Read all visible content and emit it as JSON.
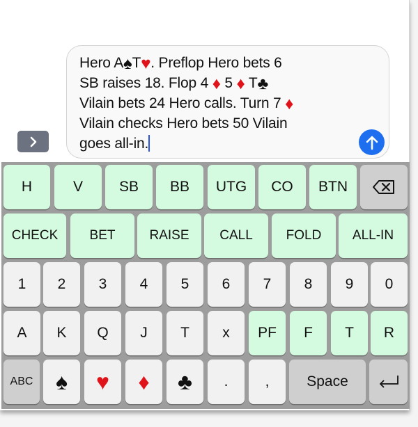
{
  "compose": {
    "expand_icon": "chevron-right-icon",
    "message_lines": [
      [
        {
          "t": "Hero A"
        },
        {
          "suit": "spade"
        },
        {
          "t": "T"
        },
        {
          "suit": "heart"
        },
        {
          "t": ". Preflop Hero bets 6"
        }
      ],
      [
        {
          "t": "SB raises 18. Flop 4 "
        },
        {
          "suit": "diamond"
        },
        {
          "t": " 5 "
        },
        {
          "suit": "diamond"
        },
        {
          "t": " T"
        },
        {
          "suit": "club"
        }
      ],
      [
        {
          "t": "Vilain bets 24 Hero calls. Turn 7 "
        },
        {
          "suit": "diamond"
        }
      ],
      [
        {
          "t": "Vilain checks Hero bets 50 Vilain"
        }
      ],
      [
        {
          "t": "goes all-in."
        },
        {
          "caret": true
        }
      ]
    ],
    "send_icon": "arrow-up-icon"
  },
  "suits": {
    "spade": {
      "glyph": "♠",
      "color": "black"
    },
    "heart": {
      "glyph": "♥",
      "color": "red"
    },
    "diamond": {
      "glyph": "♦",
      "color": "red"
    },
    "club": {
      "glyph": "♣",
      "color": "black"
    }
  },
  "colors": {
    "accent": "#1e6ef0",
    "position_key": "#d4fadf",
    "standard_key": "#f1f1f1",
    "function_key": "#cfcfcf",
    "suit_red": "#e0131a"
  },
  "keyboard": {
    "rows": [
      [
        {
          "label": "H",
          "style": "green"
        },
        {
          "label": "V",
          "style": "green"
        },
        {
          "label": "SB",
          "style": "green"
        },
        {
          "label": "BB",
          "style": "green"
        },
        {
          "label": "UTG",
          "style": "green"
        },
        {
          "label": "CO",
          "style": "green"
        },
        {
          "label": "BTN",
          "style": "green"
        },
        {
          "icon": "backspace-icon",
          "style": "gray"
        }
      ],
      [
        {
          "label": "CHECK",
          "style": "green"
        },
        {
          "label": "BET",
          "style": "green"
        },
        {
          "label": "RAISE",
          "style": "green"
        },
        {
          "label": "CALL",
          "style": "green"
        },
        {
          "label": "FOLD",
          "style": "green"
        },
        {
          "label": "ALL-IN",
          "style": "green"
        }
      ],
      [
        {
          "label": "1",
          "style": "light"
        },
        {
          "label": "2",
          "style": "light"
        },
        {
          "label": "3",
          "style": "light"
        },
        {
          "label": "4",
          "style": "light"
        },
        {
          "label": "5",
          "style": "light"
        },
        {
          "label": "6",
          "style": "light"
        },
        {
          "label": "7",
          "style": "light"
        },
        {
          "label": "8",
          "style": "light"
        },
        {
          "label": "9",
          "style": "light"
        },
        {
          "label": "0",
          "style": "light"
        }
      ],
      [
        {
          "label": "A",
          "style": "light"
        },
        {
          "label": "K",
          "style": "light"
        },
        {
          "label": "Q",
          "style": "light"
        },
        {
          "label": "J",
          "style": "light"
        },
        {
          "label": "T",
          "style": "light"
        },
        {
          "label": "x",
          "style": "light"
        },
        {
          "label": "PF",
          "style": "green"
        },
        {
          "label": "F",
          "style": "green"
        },
        {
          "label": "T",
          "style": "green"
        },
        {
          "label": "R",
          "style": "green"
        }
      ],
      [
        {
          "label": "ABC",
          "style": "gray"
        },
        {
          "suit": "spade",
          "style": "light"
        },
        {
          "suit": "heart",
          "style": "light"
        },
        {
          "suit": "diamond",
          "style": "light"
        },
        {
          "suit": "club",
          "style": "light"
        },
        {
          "label": ".",
          "style": "light"
        },
        {
          "label": ",",
          "style": "light"
        },
        {
          "label": "Space",
          "style": "gray"
        },
        {
          "icon": "return-icon",
          "style": "gray"
        }
      ]
    ]
  }
}
